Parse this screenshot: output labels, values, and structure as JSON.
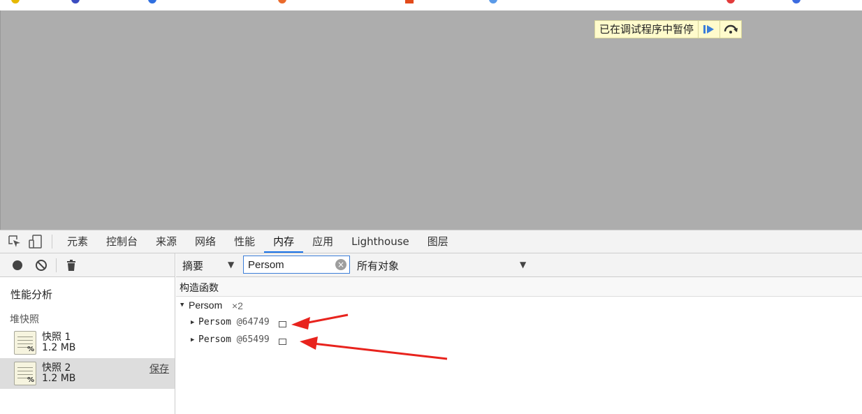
{
  "debugger_banner": {
    "text": "已在调试程序中暂停"
  },
  "devtools_tabs": {
    "items": [
      {
        "label": "元素"
      },
      {
        "label": "控制台"
      },
      {
        "label": "来源"
      },
      {
        "label": "网络"
      },
      {
        "label": "性能"
      },
      {
        "label": "内存",
        "active": true
      },
      {
        "label": "应用"
      },
      {
        "label": "Lighthouse"
      },
      {
        "label": "图层"
      }
    ]
  },
  "sidebar": {
    "title": "性能分析",
    "group_label": "堆快照",
    "snapshots": [
      {
        "name": "快照 1",
        "size": "1.2 MB"
      },
      {
        "name": "快照 2",
        "size": "1.2 MB",
        "selected": true,
        "save_label": "保存"
      }
    ]
  },
  "main_toolbar": {
    "view": "摘要",
    "filter_value": "Persom",
    "object_filter": "所有对象"
  },
  "grid": {
    "header": "构造函数",
    "group": {
      "name": "Persom",
      "count": "×2"
    },
    "instances": [
      {
        "name": "Persom",
        "id": "@64749"
      },
      {
        "name": "Persom",
        "id": "@65499"
      }
    ]
  },
  "colors": {
    "accent": "#1a73e8",
    "annotation_arrow": "#e8231d",
    "paused_overlay": "#adadad",
    "banner_bg": "#fffbcc"
  }
}
